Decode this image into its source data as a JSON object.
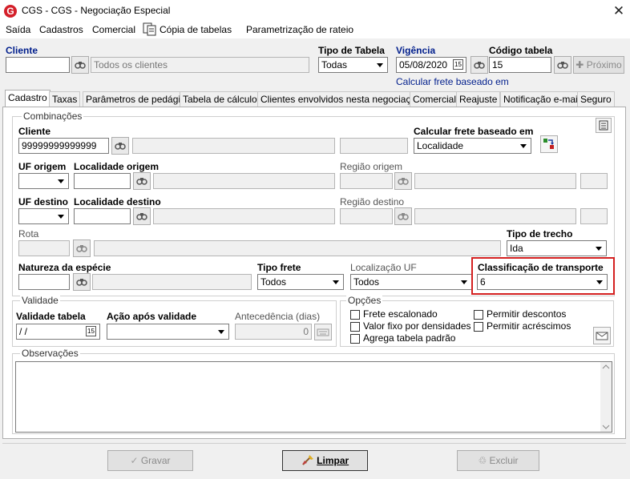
{
  "window": {
    "title": "CGS - CGS - Negociação Especial",
    "icon_letter": "G",
    "close_glyph": "✕"
  },
  "menu": {
    "items": [
      "Saída",
      "Cadastros",
      "Comercial",
      "Cópia de tabelas",
      "Parametrização de rateio"
    ]
  },
  "header": {
    "cliente_label": "Cliente",
    "cliente_value": "",
    "cliente_name": "Todos os clientes",
    "tipo_tabela_label": "Tipo de Tabela",
    "tipo_tabela_value": "Todas",
    "vigencia_label": "Vigência",
    "vigencia_value": "05/08/2020",
    "codigo_label": "Código tabela",
    "codigo_value": "15",
    "proximo_label": "Próximo",
    "calc_note": "Calcular frete baseado em"
  },
  "tabs": [
    "Cadastro",
    "Taxas",
    "Parâmetros de pedágio",
    "Tabela de cálculo",
    "Clientes envolvidos nesta negociação",
    "Comercial",
    "Reajuste",
    "Notificação e-mail",
    "Seguro"
  ],
  "combinacoes": {
    "title": "Combinações",
    "cliente_label": "Cliente",
    "cliente_value": "99999999999999",
    "calc_label": "Calcular frete baseado em",
    "calc_value": "Localidade",
    "uf_origem_label": "UF origem",
    "loc_origem_label": "Localidade origem",
    "regiao_origem_label": "Região origem",
    "uf_destino_label": "UF destino",
    "loc_destino_label": "Localidade destino",
    "regiao_destino_label": "Região destino",
    "rota_label": "Rota",
    "tipo_trecho_label": "Tipo de trecho",
    "tipo_trecho_value": "Ida",
    "natureza_label": "Natureza da espécie",
    "tipo_frete_label": "Tipo frete",
    "tipo_frete_value": "Todos",
    "localizacao_label": "Localização UF",
    "localizacao_value": "Todos",
    "classificacao_label": "Classificação de transporte",
    "classificacao_value": "6",
    "highlight_color": "#d42020"
  },
  "validade": {
    "title": "Validade",
    "validade_label": "Validade tabela",
    "validade_value": " /  /",
    "acao_label": "Ação após validade",
    "acao_value": "",
    "antecedencia_label": "Antecedência (dias)",
    "antecedencia_value": "0"
  },
  "opcoes": {
    "title": "Opções",
    "items": [
      "Frete escalonado",
      "Valor fixo por densidades",
      "Agrega tabela padrão",
      "Permitir descontos",
      "Permitir acréscimos"
    ]
  },
  "observacoes": {
    "title": "Observações",
    "value": ""
  },
  "footer": {
    "gravar": "Gravar",
    "limpar": "Limpar",
    "excluir": "Excluir"
  }
}
